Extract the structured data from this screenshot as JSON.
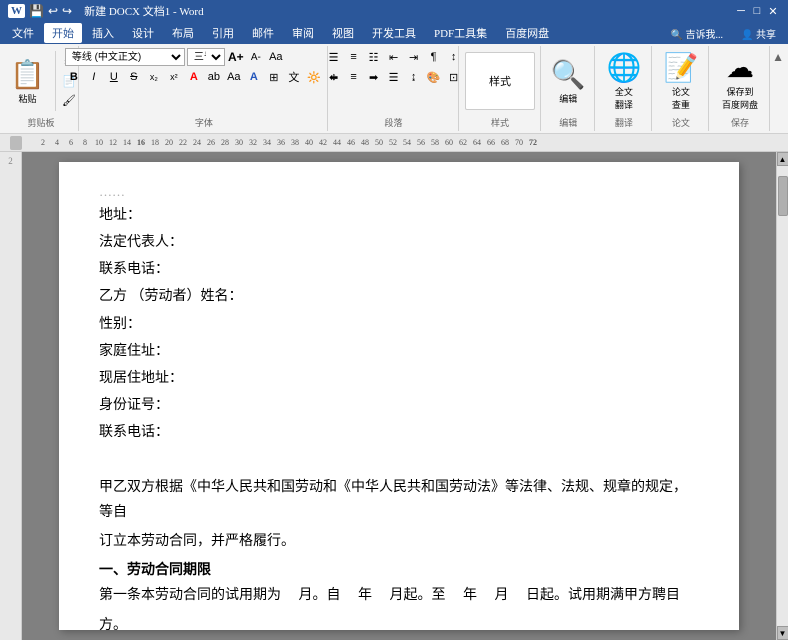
{
  "titlebar": {
    "title": "新建 DOCX 文档1 - Word",
    "left_icon": "W",
    "buttons": [
      "—",
      "□",
      "✕"
    ]
  },
  "menubar": {
    "items": [
      "文件",
      "开始",
      "插入",
      "设计",
      "布局",
      "引用",
      "邮件",
      "审阅",
      "视图",
      "开发工具",
      "PDF工具集",
      "百度网盘"
    ],
    "active": "开始",
    "right_items": [
      "吉诉我...",
      "共享"
    ]
  },
  "ribbon": {
    "groups": [
      {
        "name": "剪贴板",
        "label": "剪贴板",
        "buttons": [
          "粘贴"
        ]
      },
      {
        "name": "字体",
        "label": "字体",
        "font_name": "等线 (中文正文)",
        "font_size": "三号",
        "bold": "B",
        "italic": "I",
        "underline": "U",
        "strikethrough": "S",
        "subscript": "x₂",
        "superscript": "x²"
      },
      {
        "name": "段落",
        "label": "段落"
      },
      {
        "name": "样式",
        "label": "样式"
      },
      {
        "name": "编辑",
        "label": "编辑"
      },
      {
        "name": "翻译",
        "label": "翻译",
        "buttons": [
          "全文翻译"
        ]
      },
      {
        "name": "论文",
        "label": "论文",
        "buttons": [
          "论文查重"
        ]
      },
      {
        "name": "保存",
        "label": "保存",
        "buttons": [
          "保存到百度网盘"
        ]
      }
    ]
  },
  "ruler": {
    "numbers": [
      "2",
      "4",
      "6",
      "8",
      "10",
      "12",
      "14",
      "16",
      "18",
      "20",
      "22",
      "24",
      "26",
      "28",
      "30",
      "32",
      "34",
      "36",
      "38",
      "40",
      "42",
      "44",
      "46",
      "48",
      "50",
      "52",
      "54",
      "56",
      "58",
      "60",
      "62",
      "64",
      "66",
      "68",
      "70",
      "72"
    ]
  },
  "document": {
    "lines": [
      {
        "type": "field",
        "text": "地址："
      },
      {
        "type": "field",
        "text": "法定代表人："
      },
      {
        "type": "field",
        "text": "联系电话："
      },
      {
        "type": "field",
        "text": "乙方 （劳动者）姓名："
      },
      {
        "type": "field",
        "text": "性别："
      },
      {
        "type": "field",
        "text": "家庭住址："
      },
      {
        "type": "field",
        "text": "现居住地址："
      },
      {
        "type": "field",
        "text": "身份证号："
      },
      {
        "type": "field",
        "text": "联系电话："
      },
      {
        "type": "blank",
        "text": ""
      },
      {
        "type": "paragraph",
        "text": "甲乙双方根据《中华人民共和国劳动和《中华人民共和国劳动法》等法律、法规、规章的规定，等自"
      },
      {
        "type": "paragraph",
        "text": "订立本劳动合同，并严格履行。"
      },
      {
        "type": "section",
        "text": "一、劳动合同期限"
      },
      {
        "type": "paragraph",
        "text": "第一条本劳动合同的试用期为     月。自     年     月起。至     年     月     日起。试用期满甲方聘目"
      },
      {
        "type": "paragraph",
        "text": "方。"
      }
    ]
  }
}
